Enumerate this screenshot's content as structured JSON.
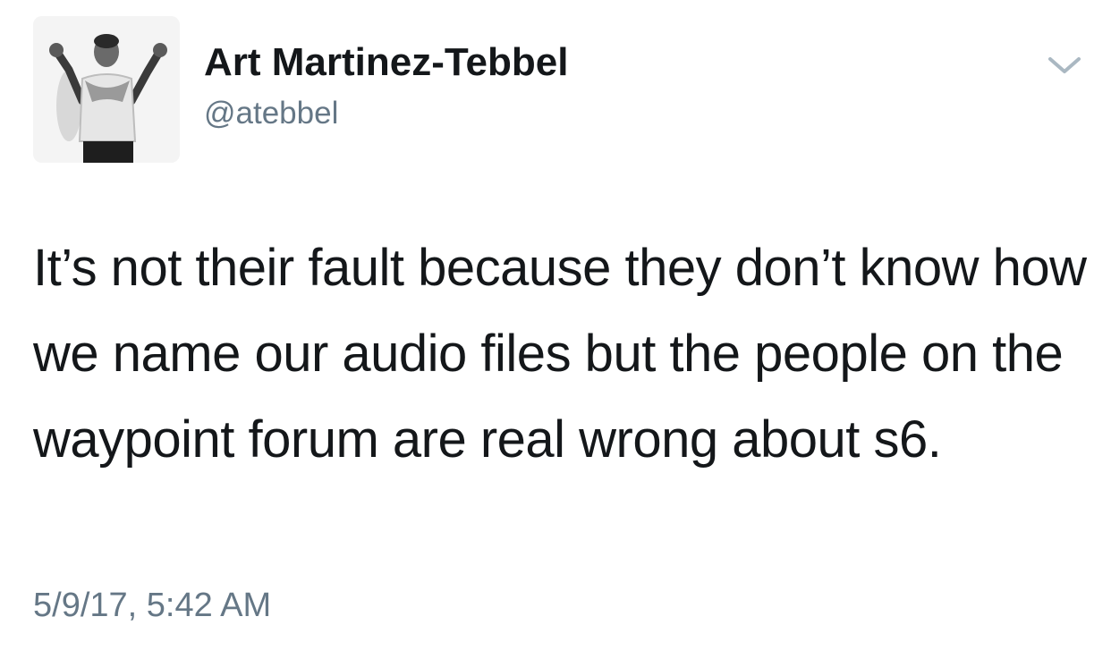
{
  "tweet": {
    "author": {
      "display_name": "Art Martinez-Tebbel",
      "handle": "@atebbel"
    },
    "text": "It’s not their fault because they don’t know how we name our audio files but the people on the waypoint forum are real wrong about s6.",
    "timestamp": "5/9/17, 5:42 AM",
    "menu_icon": "chevron-down-icon"
  },
  "colors": {
    "text_primary": "#14171a",
    "text_secondary": "#657786",
    "background": "#ffffff",
    "chevron": "#aab8c2"
  }
}
